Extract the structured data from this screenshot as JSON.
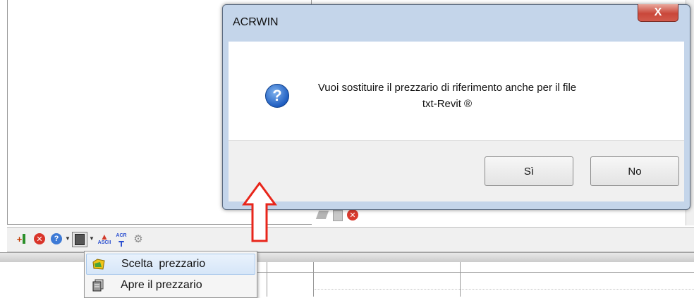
{
  "dialog": {
    "title": "ACRWIN",
    "close_label": "X",
    "message_line1": "Vuoi sostituire il prezzario di riferimento anche per il file",
    "message_line2": "txt-Revit ®",
    "icon": "question-icon",
    "yes_label": "Sì",
    "no_label": "No"
  },
  "popup_menu": {
    "items": [
      {
        "label": "Scelta  prezzario",
        "icon": "folder-pick-icon",
        "highlighted": true
      },
      {
        "label": "Apre il prezzario",
        "icon": "document-stack-icon",
        "highlighted": false
      }
    ]
  },
  "toolbar": {
    "icons": [
      "add-row-icon",
      "delete-icon",
      "help-icon",
      "price-list-icon",
      "import-ascii-icon",
      "acr-tool-icon",
      "settings-icon"
    ]
  },
  "annotation": {
    "arrow_color": "#e8261b",
    "direction": "up"
  }
}
